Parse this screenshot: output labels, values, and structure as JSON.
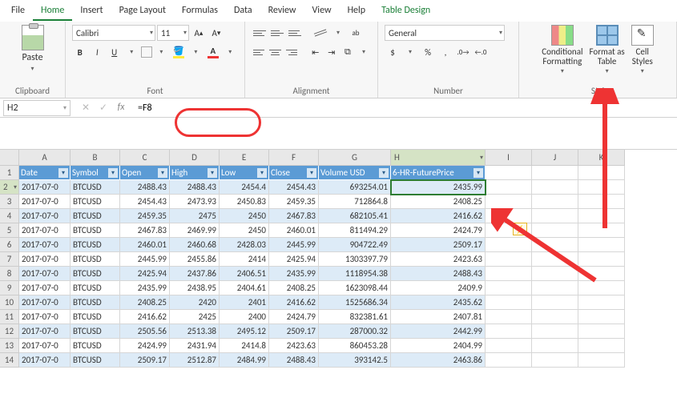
{
  "menu": [
    "File",
    "Home",
    "Insert",
    "Page Layout",
    "Formulas",
    "Data",
    "Review",
    "View",
    "Help",
    "Table Design"
  ],
  "menu_active_index": 1,
  "menu_contextual_index": 9,
  "ribbon": {
    "clipboard": {
      "paste": "Paste",
      "label": "Clipboard"
    },
    "font": {
      "name": "Calibri",
      "size": "11",
      "label": "Font"
    },
    "alignment": {
      "label": "Alignment",
      "wrap": "ab"
    },
    "number": {
      "format": "General",
      "label": "Number"
    },
    "styles": {
      "conditional": "Conditional\nFormatting",
      "format_as": "Format as\nTable",
      "cell_styles": "Cell\nStyles",
      "label": "Styl"
    }
  },
  "namebox": "H2",
  "formula": "=F8",
  "columns": [
    "A",
    "B",
    "C",
    "D",
    "E",
    "F",
    "G",
    "H",
    "I",
    "J",
    "K"
  ],
  "headers": [
    "Date",
    "Symbol",
    "Open",
    "High",
    "Low",
    "Close",
    "Volume USD",
    "6-HR-FuturePrice"
  ],
  "rows": [
    [
      "2017-07-0",
      "BTCUSD",
      "2488.43",
      "2488.43",
      "2454.4",
      "2454.43",
      "693254.01",
      "2435.99"
    ],
    [
      "2017-07-0",
      "BTCUSD",
      "2454.43",
      "2473.93",
      "2450.83",
      "2459.35",
      "712864.8",
      "2408.25"
    ],
    [
      "2017-07-0",
      "BTCUSD",
      "2459.35",
      "2475",
      "2450",
      "2467.83",
      "682105.41",
      "2416.62"
    ],
    [
      "2017-07-0",
      "BTCUSD",
      "2467.83",
      "2469.99",
      "2450",
      "2460.01",
      "811494.29",
      "2424.79"
    ],
    [
      "2017-07-0",
      "BTCUSD",
      "2460.01",
      "2460.68",
      "2428.03",
      "2445.99",
      "904722.49",
      "2509.17"
    ],
    [
      "2017-07-0",
      "BTCUSD",
      "2445.99",
      "2455.86",
      "2414",
      "2425.94",
      "1303397.79",
      "2423.63"
    ],
    [
      "2017-07-0",
      "BTCUSD",
      "2425.94",
      "2437.86",
      "2406.51",
      "2435.99",
      "1118954.38",
      "2488.43"
    ],
    [
      "2017-07-0",
      "BTCUSD",
      "2435.99",
      "2438.95",
      "2404.61",
      "2408.25",
      "1623098.44",
      "2409.9"
    ],
    [
      "2017-07-0",
      "BTCUSD",
      "2408.25",
      "2420",
      "2401",
      "2416.62",
      "1525686.34",
      "2435.62"
    ],
    [
      "2017-07-0",
      "BTCUSD",
      "2416.62",
      "2425",
      "2400",
      "2424.79",
      "832381.61",
      "2407.81"
    ],
    [
      "2017-07-0",
      "BTCUSD",
      "2505.56",
      "2513.38",
      "2495.12",
      "2509.17",
      "287000.32",
      "2442.99"
    ],
    [
      "2017-07-0",
      "BTCUSD",
      "2424.99",
      "2431.94",
      "2414.8",
      "2423.63",
      "860453.28",
      "2404.99"
    ],
    [
      "2017-07-0",
      "BTCUSD",
      "2509.17",
      "2512.87",
      "2484.99",
      "2488.43",
      "393142.5",
      "2463.86"
    ]
  ],
  "active_cell": {
    "col": "H",
    "row": 2
  }
}
